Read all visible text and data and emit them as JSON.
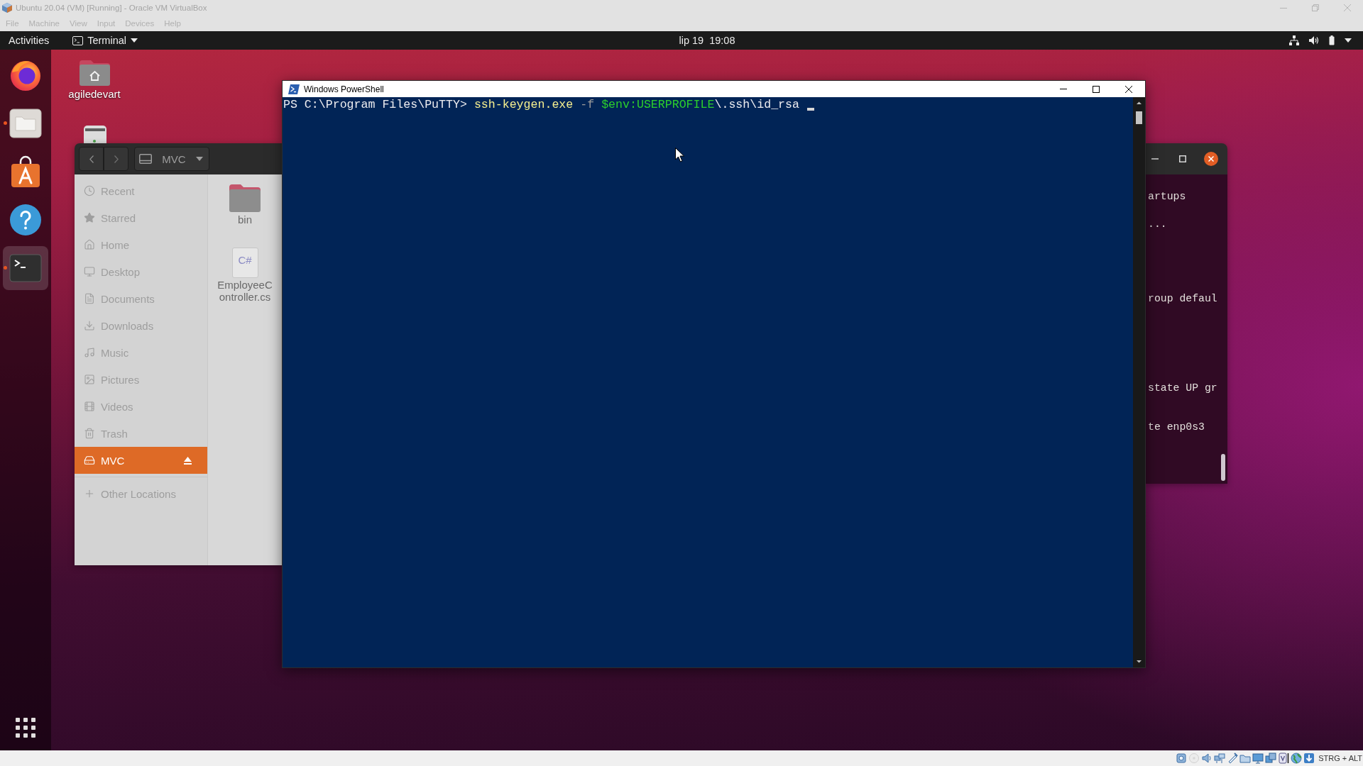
{
  "host_window": {
    "title": "Ubuntu 20.04 (VM) [Running] - Oracle VM VirtualBox",
    "menu": [
      "File",
      "Machine",
      "View",
      "Input",
      "Devices",
      "Help"
    ]
  },
  "top_bar": {
    "activities": "Activities",
    "app_menu": "Terminal",
    "clock": "lip 19  19:08"
  },
  "dock": {
    "items": [
      {
        "kind": "browser",
        "running": false,
        "selected": false
      },
      {
        "kind": "files",
        "running": true,
        "selected": false
      },
      {
        "kind": "software",
        "running": false,
        "selected": false
      },
      {
        "kind": "help",
        "running": false,
        "selected": false
      },
      {
        "kind": "terminal",
        "running": true,
        "selected": true
      }
    ]
  },
  "desktop_icons": [
    {
      "kind": "home",
      "label": "agiledevart"
    },
    {
      "kind": "drive"
    }
  ],
  "file_manager": {
    "path": "MVC",
    "sidebar": [
      {
        "kind": "recent",
        "label": "Recent",
        "selected": false
      },
      {
        "kind": "starred",
        "label": "Starred",
        "selected": false
      },
      {
        "kind": "home",
        "label": "Home",
        "selected": false
      },
      {
        "kind": "desktop",
        "label": "Desktop",
        "selected": false
      },
      {
        "kind": "documents",
        "label": "Documents",
        "selected": false
      },
      {
        "kind": "downloads",
        "label": "Downloads",
        "selected": false
      },
      {
        "kind": "music",
        "label": "Music",
        "selected": false
      },
      {
        "kind": "pictures",
        "label": "Pictures",
        "selected": false
      },
      {
        "kind": "videos",
        "label": "Videos",
        "selected": false
      },
      {
        "kind": "trash",
        "label": "Trash",
        "selected": false
      },
      {
        "kind": "drive",
        "label": "MVC",
        "selected": true
      },
      {
        "kind": "other",
        "label": "Other Locations",
        "selected": false
      }
    ],
    "files": [
      {
        "kind": "folder",
        "name": "bin"
      },
      {
        "kind": "code",
        "name": "EmployeeController.cs",
        "badge": "C#"
      }
    ]
  },
  "powershell": {
    "title": "Windows PowerShell",
    "lines": [
      {
        "segments": [
          {
            "kind": "prompt",
            "text": "PS C:\\Program Files\\PuTTY> "
          },
          {
            "kind": "command",
            "text": "ssh-keygen.exe"
          },
          {
            "kind": "parameter",
            "text": " -f"
          },
          {
            "kind": "variable",
            "text": " $env:USERPROFILE"
          },
          {
            "kind": "argument",
            "text": "\\.ssh\\id_rsa"
          }
        ]
      }
    ],
    "cursor": true
  },
  "terminal": {
    "lines": [
      "artups",
      "...",
      "roup defaul",
      "state UP gr",
      "te enp0s3"
    ]
  },
  "status_bar": {
    "host_key": "STRG + ALT"
  }
}
